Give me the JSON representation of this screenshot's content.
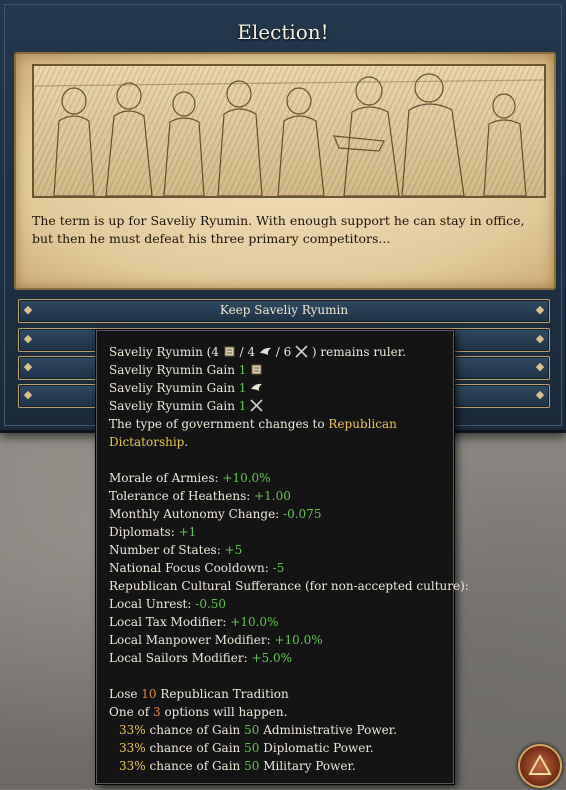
{
  "event": {
    "title": "Election!",
    "description": "The term is up for Saveliy Ryumin. With enough support he can stay in office, but then he must defeat his three primary competitors..."
  },
  "options": [
    {
      "label": "Keep Saveliy Ryumin"
    },
    {
      "label": ""
    },
    {
      "label": ""
    },
    {
      "label": ""
    }
  ],
  "tooltip": {
    "ruler_prefix": "Saveliy Ryumin (4",
    "ruler_sep1": "/ 4",
    "ruler_sep2": "/ 6",
    "ruler_suffix": ") remains ruler.",
    "gain_label": "Saveliy Ryumin Gain",
    "gain_adm": "1",
    "gain_dip": "1",
    "gain_mil": "1",
    "gov_prefix": "The type of government changes to",
    "gov_value": "Republican Dictatorship",
    "gov_suffix": ".",
    "modifiers": [
      {
        "label": "Morale of Armies:",
        "value": "+10.0%"
      },
      {
        "label": "Tolerance of Heathens:",
        "value": "+1.00"
      },
      {
        "label": "Monthly Autonomy Change:",
        "value": "-0.075"
      },
      {
        "label": "Diplomats:",
        "value": "+1"
      },
      {
        "label": "Number of States:",
        "value": "+5"
      },
      {
        "label": "National Focus Cooldown:",
        "value": "-5"
      },
      {
        "label": "Republican Cultural Sufferance (for non-accepted culture):",
        "value": ""
      },
      {
        "label": "Local Unrest:",
        "value": "-0.50"
      },
      {
        "label": "Local Tax Modifier:",
        "value": "+10.0%"
      },
      {
        "label": "Local Manpower Modifier:",
        "value": "+10.0%"
      },
      {
        "label": "Local Sailors Modifier:",
        "value": "+5.0%"
      }
    ],
    "lose_prefix": "Lose",
    "lose_value": "10",
    "lose_suffix": "Republican Tradition",
    "one_of_prefix": "One of",
    "one_of_value": "3",
    "one_of_suffix": "options will happen.",
    "chances": [
      {
        "pct": "33%",
        "mid": "chance of Gain",
        "amount": "50",
        "what": "Administrative Power."
      },
      {
        "pct": "33%",
        "mid": "chance of Gain",
        "amount": "50",
        "what": "Diplomatic Power."
      },
      {
        "pct": "33%",
        "mid": "chance of Gain",
        "amount": "50",
        "what": "Military Power."
      }
    ]
  },
  "icons": {
    "adm": "scroll-icon",
    "dip": "dove-icon",
    "mil": "crossed-swords-icon",
    "corner": "triangle-menu-icon"
  },
  "colors": {
    "positive": "#62c152",
    "highlight": "#e6c449",
    "negative_num": "#e0883a"
  }
}
